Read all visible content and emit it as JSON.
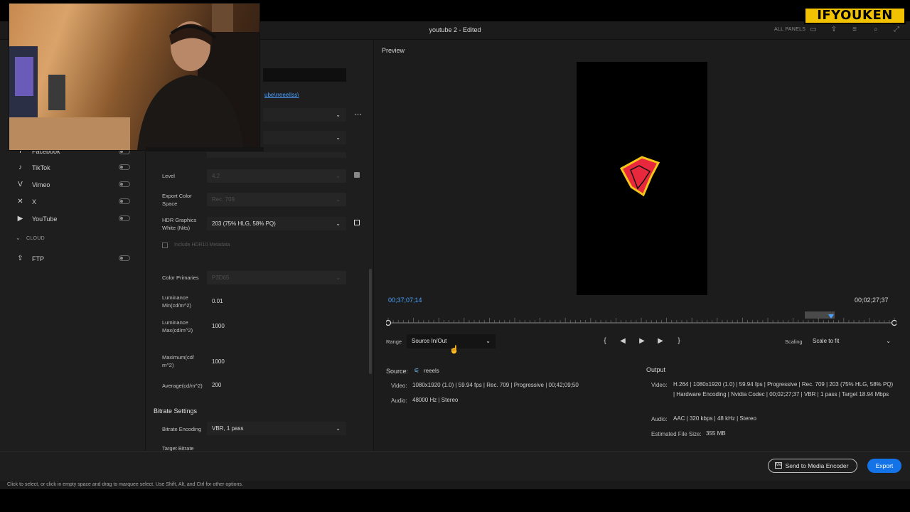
{
  "window": {
    "title": "youtube 2 - Edited",
    "panels_label": "ALL PANELS"
  },
  "brand": {
    "text": "IFYOUKEN"
  },
  "left_panel": {
    "destinations": [
      {
        "label": "Facebook",
        "icon": "facebook-icon"
      },
      {
        "label": "TikTok",
        "icon": "tiktok-icon"
      },
      {
        "label": "Vimeo",
        "icon": "vimeo-icon"
      },
      {
        "label": "X",
        "icon": "x-icon"
      },
      {
        "label": "YouTube",
        "icon": "youtube-icon"
      }
    ],
    "cloud_label": "CLOUD",
    "cloud_items": [
      {
        "label": "FTP",
        "icon": "upload-icon"
      }
    ]
  },
  "settings": {
    "path_link": "ube\\rreeelIss\\",
    "level": {
      "label": "Level",
      "value": "4.2"
    },
    "export_color_space": {
      "label": "Export Color Space",
      "value": "Rec. 709"
    },
    "hdr_graphics": {
      "label": "HDR Graphics White (Nits)",
      "value": "203 (75% HLG, 58% PQ)"
    },
    "include_hdr10": {
      "label": "Include HDR10 Metadata"
    },
    "color_primaries": {
      "label": "Color Primaries",
      "value": "P3D65"
    },
    "lum_min": {
      "label": "Luminance Min(cd/m^2)",
      "value": "0.01"
    },
    "lum_max": {
      "label": "Luminance Max(cd/m^2)",
      "value": "1000"
    },
    "maximum": {
      "label": "Maximum(cd/ m^2)",
      "value": "1000"
    },
    "average": {
      "label": "Average(cd/m^2)",
      "value": "200"
    },
    "bitrate_section": "Bitrate Settings",
    "bitrate_encoding": {
      "label": "Bitrate Encoding",
      "value": "VBR, 1 pass"
    },
    "target_bitrate": {
      "label": "Target Bitrate"
    }
  },
  "preview": {
    "label": "Preview",
    "timecode_current": "00;37;07;14",
    "timecode_duration": "00;02;27;37",
    "range_label": "Range",
    "range_value": "Source In/Out",
    "scaling_label": "Scaling",
    "scaling_value": "Scale to fit"
  },
  "source": {
    "heading": "Source:",
    "name": "reeels",
    "video_key": "Video:",
    "video_value": "1080x1920 (1.0)  |  59.94 fps  |  Rec. 709  |  Progressive  |  00;42;09;50",
    "audio_key": "Audio:",
    "audio_value": "48000 Hz  |  Stereo"
  },
  "output": {
    "heading": "Output",
    "video_key": "Video:",
    "video_value": "H.264  |  1080x1920 (1.0)  |  59.94 fps  |  Progressive  |  Rec. 709  |  203 (75% HLG, 58% PQ)  |  Hardware Encoding  |  Nvidia Codec  |  00;02;27;37  |  VBR  |  1 pass  |  Target 18.94 Mbps",
    "audio_key": "Audio:",
    "audio_value": "AAC  |  320 kbps  |  48 kHz  |  Stereo",
    "size_key": "Estimated File Size:",
    "size_value": "355 MB"
  },
  "buttons": {
    "send": "Send to Media Encoder",
    "export": "Export"
  },
  "status": "Click to select, or click in empty space and drag to marquee select. Use Shift, Alt, and Ctrl for other options.",
  "colors": {
    "accent": "#1473e6",
    "timecode": "#4aa3ff",
    "brand_bg": "#f2c200",
    "logo_red": "#e8283c",
    "logo_yellow": "#f5c518"
  }
}
